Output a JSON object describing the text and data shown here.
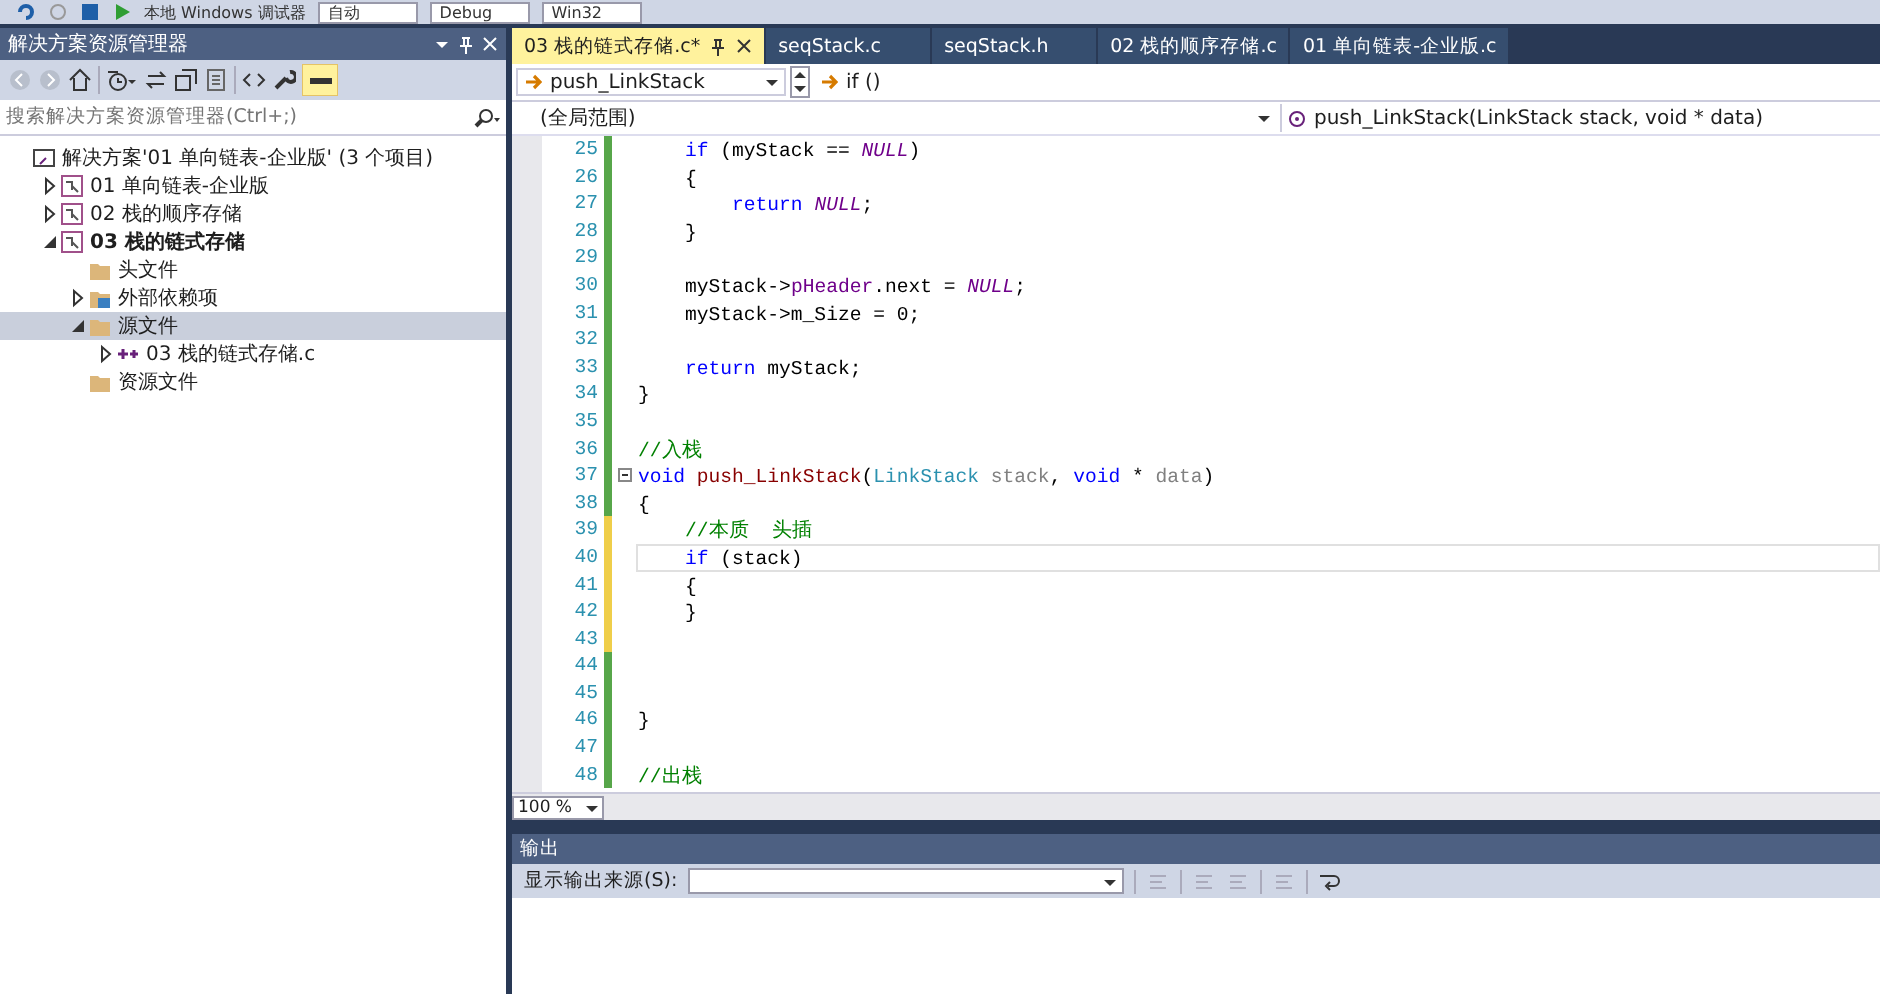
{
  "toolbar": {
    "items": [
      "本地 Windows 调试器",
      "自动",
      "Debug",
      "Win32"
    ]
  },
  "solution_explorer": {
    "title": "解决方案资源管理器",
    "search": {
      "placeholder": "搜索解决方案资源管理器(Ctrl+;)"
    },
    "tree": [
      {
        "label": "解决方案'01 单向链表-企业版' (3 个项目)",
        "kind": "solution",
        "selected": false,
        "children": [
          {
            "label": "01 单向链表-企业版",
            "kind": "project",
            "startup": false,
            "expanded": false,
            "selected": false
          },
          {
            "label": "02 栈的顺序存储",
            "kind": "project",
            "startup": false,
            "expanded": false,
            "selected": false
          },
          {
            "label": "03 栈的链式存储",
            "kind": "project",
            "startup": true,
            "expanded": true,
            "selected": false,
            "children": [
              {
                "label": "头文件",
                "kind": "folder",
                "selected": false
              },
              {
                "label": "外部依赖项",
                "kind": "dependencies",
                "expanded": false,
                "selected": false
              },
              {
                "label": "源文件",
                "kind": "folder",
                "expanded": true,
                "selected": true,
                "children": [
                  {
                    "label": "03 栈的链式存储.c",
                    "kind": "source",
                    "expanded": false,
                    "selected": false
                  }
                ]
              },
              {
                "label": "资源文件",
                "kind": "folder",
                "selected": false
              }
            ]
          }
        ]
      }
    ]
  },
  "editor": {
    "tabs": [
      {
        "label": "03 栈的链式存储.c*",
        "selected": true
      },
      {
        "label": "seqStack.c",
        "selected": false
      },
      {
        "label": "seqStack.h",
        "selected": false
      },
      {
        "label": "02 栈的顺序存储.c",
        "selected": false
      },
      {
        "label": "01 单向链表-企业版.c",
        "selected": false
      }
    ],
    "member_combo": "push_LinkStack",
    "position_combo": "if ()",
    "scope_combo": "(全局范围)",
    "function_combo": "push_LinkStack(LinkStack stack, void * data)",
    "lines": [
      {
        "n": "25",
        "modified": false,
        "current": false,
        "fold": false,
        "tokens": [
          {
            "t": "    if",
            "kind": "keyword"
          },
          {
            "t": " (myStack == ",
            "kind": "plain"
          },
          {
            "t": "NULL",
            "kind": "macro"
          },
          {
            "t": ")",
            "kind": "plain"
          }
        ]
      },
      {
        "n": "26",
        "modified": false,
        "current": false,
        "fold": false,
        "tokens": [
          {
            "t": "    {",
            "kind": "plain"
          }
        ]
      },
      {
        "n": "27",
        "modified": false,
        "current": false,
        "fold": false,
        "tokens": [
          {
            "t": "        return",
            "kind": "keyword"
          },
          {
            "t": " NULL",
            "kind": "macro"
          },
          {
            "t": ";",
            "kind": "plain"
          }
        ]
      },
      {
        "n": "28",
        "modified": false,
        "current": false,
        "fold": false,
        "tokens": [
          {
            "t": "    }",
            "kind": "plain"
          }
        ]
      },
      {
        "n": "29",
        "modified": false,
        "current": false,
        "fold": false
      },
      {
        "n": "30",
        "modified": false,
        "current": false,
        "fold": false,
        "tokens": [
          {
            "t": "    myStack->",
            "kind": "plain"
          },
          {
            "t": "pHeader",
            "kind": "member"
          },
          {
            "t": ".next = ",
            "kind": "plain"
          },
          {
            "t": "NULL",
            "kind": "macro"
          },
          {
            "t": ";",
            "kind": "plain"
          }
        ]
      },
      {
        "n": "31",
        "modified": false,
        "current": false,
        "fold": false,
        "tokens": [
          {
            "t": "    myStack->m_Size = 0;",
            "kind": "plain"
          }
        ]
      },
      {
        "n": "32",
        "modified": false,
        "current": false,
        "fold": false
      },
      {
        "n": "33",
        "modified": false,
        "current": false,
        "fold": false,
        "tokens": [
          {
            "t": "    return",
            "kind": "keyword"
          },
          {
            "t": " myStack;",
            "kind": "plain"
          }
        ]
      },
      {
        "n": "34",
        "modified": false,
        "current": false,
        "fold": false,
        "tokens": [
          {
            "t": "}",
            "kind": "plain"
          }
        ]
      },
      {
        "n": "35",
        "modified": false,
        "current": false,
        "fold": false
      },
      {
        "n": "36",
        "modified": false,
        "current": false,
        "fold": false,
        "tokens": [
          {
            "t": "//入栈",
            "kind": "comment"
          }
        ]
      },
      {
        "n": "37",
        "modified": false,
        "current": false,
        "fold": true,
        "tokens": [
          {
            "t": "void",
            "kind": "keyword"
          },
          {
            "t": " push_LinkStack",
            "kind": "function"
          },
          {
            "t": "(",
            "kind": "plain"
          },
          {
            "t": "LinkStack",
            "kind": "type"
          },
          {
            "t": " stack",
            "kind": "param"
          },
          {
            "t": ", ",
            "kind": "plain"
          },
          {
            "t": "void",
            "kind": "keyword"
          },
          {
            "t": " * ",
            "kind": "plain"
          },
          {
            "t": "data",
            "kind": "param"
          },
          {
            "t": ")",
            "kind": "plain"
          }
        ]
      },
      {
        "n": "38",
        "modified": false,
        "current": false,
        "fold": false,
        "tokens": [
          {
            "t": "{",
            "kind": "plain"
          }
        ]
      },
      {
        "n": "39",
        "modified": true,
        "current": false,
        "fold": false,
        "tokens": [
          {
            "t": "    //本质  头插",
            "kind": "comment"
          }
        ]
      },
      {
        "n": "40",
        "modified": true,
        "current": true,
        "fold": false,
        "tokens": [
          {
            "t": "    if",
            "kind": "keyword"
          },
          {
            "t": " (stack)",
            "kind": "plain"
          }
        ]
      },
      {
        "n": "41",
        "modified": true,
        "current": false,
        "fold": false,
        "tokens": [
          {
            "t": "    {",
            "kind": "plain"
          }
        ]
      },
      {
        "n": "42",
        "modified": true,
        "current": false,
        "fold": false,
        "tokens": [
          {
            "t": "    }",
            "kind": "plain"
          }
        ]
      },
      {
        "n": "43",
        "modified": true,
        "current": false,
        "fold": false
      },
      {
        "n": "44",
        "modified": false,
        "current": false,
        "fold": false
      },
      {
        "n": "45",
        "modified": false,
        "current": false,
        "fold": false
      },
      {
        "n": "46",
        "modified": false,
        "current": false,
        "fold": false,
        "tokens": [
          {
            "t": "}",
            "kind": "plain"
          }
        ]
      },
      {
        "n": "47",
        "modified": false,
        "current": false,
        "fold": false
      },
      {
        "n": "48",
        "modified": false,
        "current": false,
        "fold": false,
        "tokens": [
          {
            "t": "//出栈",
            "kind": "comment"
          }
        ]
      }
    ],
    "zoom": "100 %"
  },
  "output": {
    "title": "输出",
    "source_label": "显示输出来源(S):"
  }
}
